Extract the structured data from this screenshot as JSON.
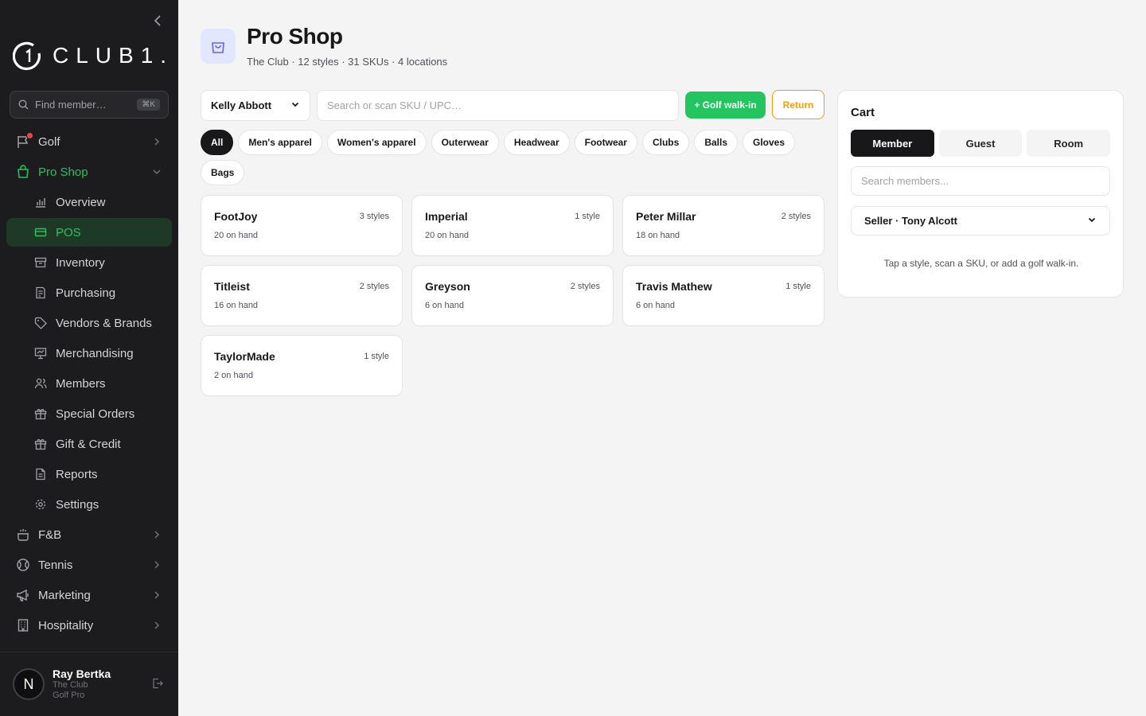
{
  "sidebar": {
    "logo_text": "CLUB1.",
    "search": {
      "placeholder": "Find member…",
      "shortcut": "⌘K"
    },
    "nav": [
      {
        "label": "Golf",
        "icon": "flag-icon"
      },
      {
        "label": "Pro Shop",
        "icon": "bag-icon"
      },
      {
        "label": "Overview",
        "icon": "bar-chart-icon"
      },
      {
        "label": "POS",
        "icon": "credit-card-icon"
      },
      {
        "label": "Inventory",
        "icon": "archive-icon"
      },
      {
        "label": "Purchasing",
        "icon": "receipt-icon"
      },
      {
        "label": "Vendors & Brands",
        "icon": "tag-icon"
      },
      {
        "label": "Merchandising",
        "icon": "presentation-icon"
      },
      {
        "label": "Members",
        "icon": "users-icon"
      },
      {
        "label": "Special Orders",
        "icon": "gift-icon"
      },
      {
        "label": "Gift & Credit",
        "icon": "gift-card-icon"
      },
      {
        "label": "Reports",
        "icon": "file-icon"
      },
      {
        "label": "Settings",
        "icon": "gear-icon"
      },
      {
        "label": "F&B",
        "icon": "cooking-pot-icon"
      },
      {
        "label": "Tennis",
        "icon": "tennis-ball-icon"
      },
      {
        "label": "Marketing",
        "icon": "megaphone-icon"
      },
      {
        "label": "Hospitality",
        "icon": "building-icon"
      }
    ],
    "user": {
      "initial": "N",
      "name": "Ray Bertka",
      "club": "The Club",
      "role": "Golf Pro"
    }
  },
  "header": {
    "title": "Pro Shop",
    "subtitle": "The Club · 12 styles · 31 SKUs · 4 locations"
  },
  "toolbar": {
    "member": "Kelly Abbott",
    "sku_placeholder": "Search or scan SKU / UPC…",
    "walkin_label": "+ Golf walk-in",
    "return_label": "Return"
  },
  "categories": [
    "All",
    "Men's apparel",
    "Women's apparel",
    "Outerwear",
    "Headwear",
    "Footwear",
    "Clubs",
    "Balls",
    "Gloves",
    "Bags"
  ],
  "brands": [
    {
      "name": "FootJoy",
      "styles": "3 styles",
      "on_hand": "20 on hand"
    },
    {
      "name": "Imperial",
      "styles": "1 style",
      "on_hand": "20 on hand"
    },
    {
      "name": "Peter Millar",
      "styles": "2 styles",
      "on_hand": "18 on hand"
    },
    {
      "name": "Titleist",
      "styles": "2 styles",
      "on_hand": "16 on hand"
    },
    {
      "name": "Greyson",
      "styles": "2 styles",
      "on_hand": "6 on hand"
    },
    {
      "name": "Travis Mathew",
      "styles": "1 style",
      "on_hand": "6 on hand"
    },
    {
      "name": "TaylorMade",
      "styles": "1 style",
      "on_hand": "2 on hand"
    }
  ],
  "cart": {
    "title": "Cart",
    "tabs": [
      "Member",
      "Guest",
      "Room"
    ],
    "search_placeholder": "Search members...",
    "seller": "Seller · Tony Alcott",
    "hint": "Tap a style, scan a SKU, or add a golf walk-in."
  },
  "colors": {
    "accent": "#22c55e",
    "return": "#f59e0b",
    "sidebar_bg": "#1c1c1e"
  }
}
